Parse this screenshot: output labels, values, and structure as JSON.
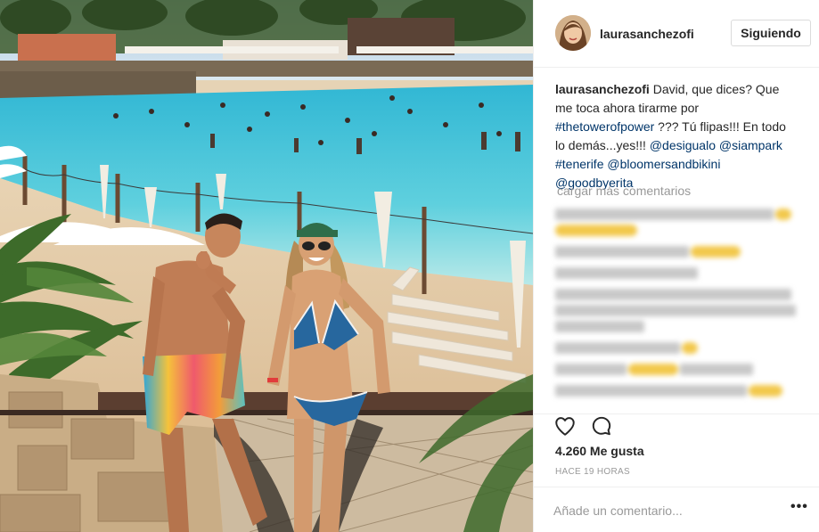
{
  "post": {
    "username": "laurasanchezofi",
    "follow_label": "Siguiendo",
    "caption": {
      "username": "laurasanchezofi",
      "text_1": " David, que dices? Que me toca ahora tirarme por ",
      "tag_1": "#thetowerofpower",
      "text_2": " ??? Tú flipas!!! En todo lo demás...yes!!! ",
      "tag_2": "@desigualo",
      "tag_3": "@siampark",
      "tag_4": "#tenerife",
      "tag_5": "@bloomersandbikini",
      "tag_6": "@goodbyerita"
    },
    "load_more_label": "cargar más comentarios",
    "likes_label": "4.260 Me gusta",
    "time_label": "HACE 19 HORAS",
    "comment_placeholder": "Añade un comentario...",
    "more_label": "•••"
  },
  "icons": {
    "like": "heart-outline-icon",
    "comment": "speech-bubble-icon",
    "more": "ellipsis-icon"
  },
  "colors": {
    "link": "#003569",
    "muted": "#999999",
    "text": "#262626"
  }
}
